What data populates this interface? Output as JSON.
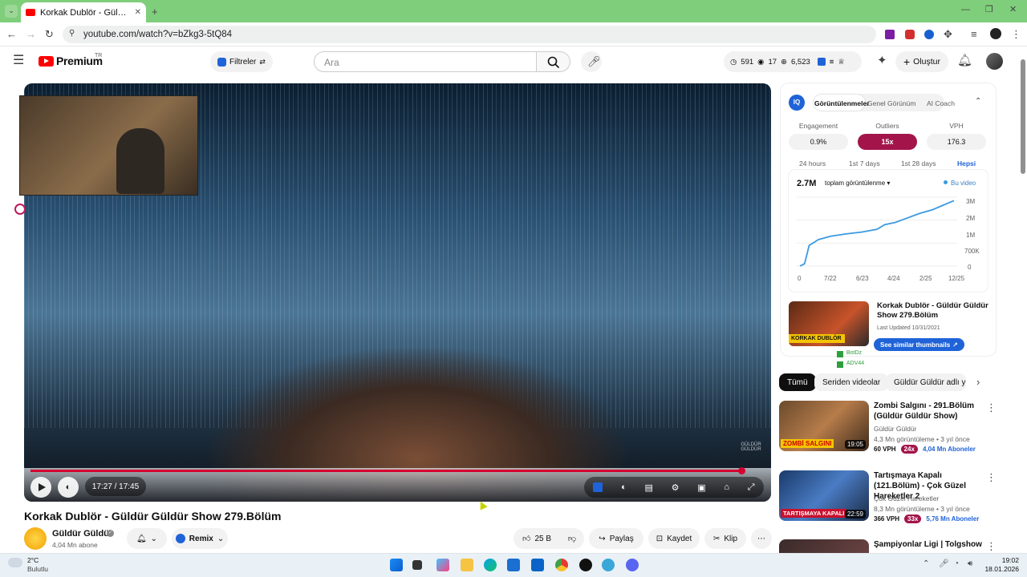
{
  "browser": {
    "tab_title": "Korkak Dublör - Güldür Güldür",
    "url": "youtube.com/watch?v=bZkg3-5tQ84"
  },
  "header": {
    "brand": "Premium",
    "brand_suffix": "TR",
    "filters_label": "Filtreler",
    "search_placeholder": "Ara",
    "stat_views": "591",
    "stat_eye": "17",
    "stat_total": "6,523",
    "create_label": "Oluştur"
  },
  "player": {
    "time": "17:27 / 17:45",
    "progress": 0.983,
    "watermark": "GÜLDÜR GÜLDÜR"
  },
  "video": {
    "title": "Korkak Dublör - Güldür Güldür Show 279.Bölüm",
    "channel": "Güldür Güldür",
    "subscribers": "4,04 Mn abone",
    "remix_label": "Remix",
    "likes": "25 B",
    "share_label": "Paylaş",
    "save_label": "Kaydet",
    "clip_label": "Klip"
  },
  "panel": {
    "tabs": [
      "Görüntülenmeler",
      "Genel Görünüm",
      "AI Coach"
    ],
    "metrics": [
      {
        "label": "Engagement",
        "value": "0.9%"
      },
      {
        "label": "Outliers",
        "value": "15x"
      },
      {
        "label": "VPH",
        "value": "176.3"
      }
    ],
    "ranges": [
      "24 hours",
      "1st 7 days",
      "1st 28 days",
      "Hepsi"
    ],
    "total": "2.7M",
    "metric_select": "toplam görüntülenme",
    "legend": "Bu video",
    "video_card_title": "Korkak Dublör - Güldür Güldür Show 279.Bölüm",
    "video_card_updated": "Last Updated 10/31/2021",
    "thumb_label": "KORKAK DUBLÖR",
    "similar_label": "See similar thumbnails",
    "tag_1": "BotDz",
    "tag_2": "ADV44"
  },
  "chart_data": {
    "type": "line",
    "x_ticks": [
      "0",
      "7/22",
      "6/23",
      "4/24",
      "2/25",
      "12/25"
    ],
    "y_ticks": [
      "3M",
      "2M",
      "1M",
      "700K",
      "0"
    ],
    "ylim": [
      0,
      3000000
    ],
    "series": [
      {
        "name": "Bu video",
        "values": [
          [
            0,
            0
          ],
          [
            0.03,
            100000
          ],
          [
            0.06,
            900000
          ],
          [
            0.12,
            1150000
          ],
          [
            0.2,
            1300000
          ],
          [
            0.3,
            1400000
          ],
          [
            0.4,
            1480000
          ],
          [
            0.5,
            1600000
          ],
          [
            0.55,
            1800000
          ],
          [
            0.62,
            1900000
          ],
          [
            0.7,
            2100000
          ],
          [
            0.78,
            2300000
          ],
          [
            0.86,
            2450000
          ],
          [
            0.93,
            2650000
          ],
          [
            1.0,
            2850000
          ]
        ]
      }
    ]
  },
  "chips": [
    "Tümü",
    "Seriden videolar",
    "Güldür Güldür adlı yü"
  ],
  "recommended": [
    {
      "title": "Zombi Salgını - 291.Bölüm (Güldür Güldür Show)",
      "channel": "Güldür Güldür",
      "meta": "4,3 Mn görüntüleme • 3 yıl önce",
      "duration": "19:05",
      "thumb_text": "ZOMBİ SALGINI",
      "vph": "60 VPH",
      "outlier": "24x",
      "subs": "4,04 Mn Aboneler"
    },
    {
      "title": "Tartışmaya Kapalı (121.Bölüm) - Çok Güzel Hareketler 2",
      "channel": "Çok Güzel Hareketler",
      "meta": "8,3 Mn görüntüleme • 3 yıl önce",
      "duration": "22:59",
      "thumb_text": "TARTIŞMAYA KAPALI",
      "vph": "366 VPH",
      "outlier": "33x",
      "subs": "5,76 Mn Aboneler"
    },
    {
      "title": "Şampiyonlar Ligi | Tolgshow",
      "channel": "",
      "meta": "",
      "duration": "",
      "thumb_text": "",
      "vph": "",
      "outlier": "",
      "subs": ""
    }
  ],
  "taskbar": {
    "temp": "2°C",
    "weather": "Bulutlu",
    "time": "19:02",
    "date": "18.01.2026"
  }
}
